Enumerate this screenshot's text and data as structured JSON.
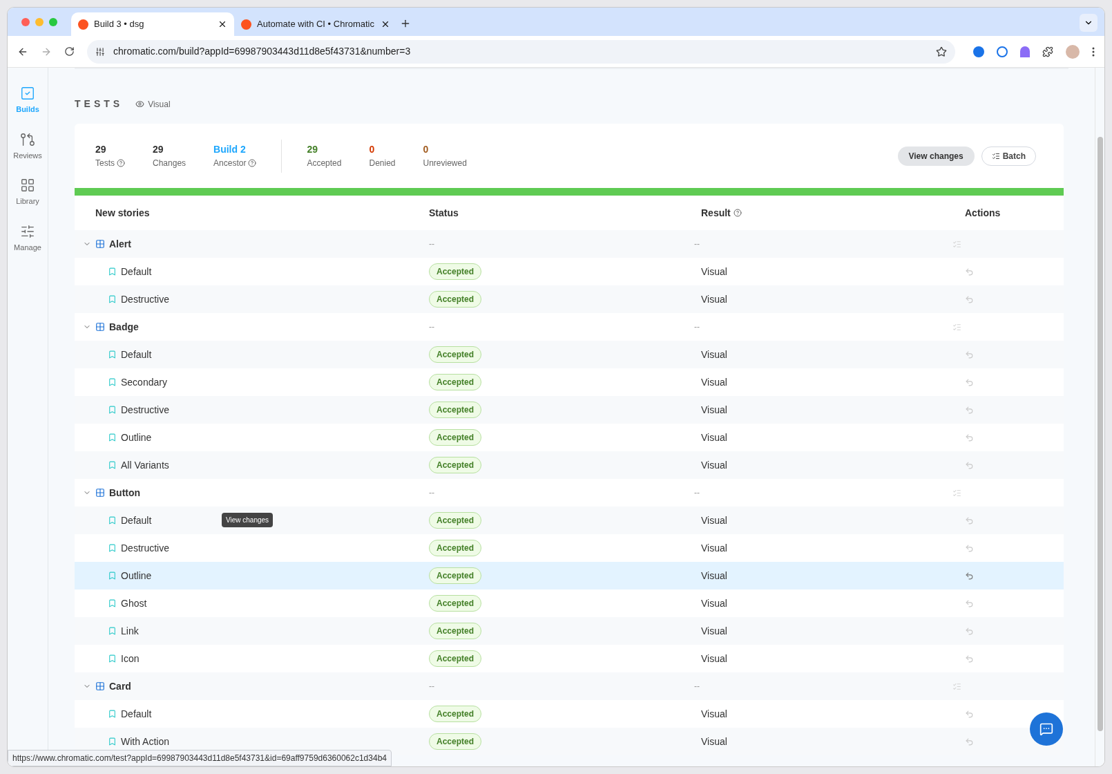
{
  "browser": {
    "tabs": [
      {
        "title": "Build 3 • dsg",
        "selected": true
      },
      {
        "title": "Automate with CI • Chromatic",
        "selected": false
      }
    ],
    "url": "chromatic.com/build?appId=69987903443d11d8e5f43731&number=3"
  },
  "sidebar": {
    "items": [
      {
        "label": "Builds",
        "selected": true
      },
      {
        "label": "Reviews",
        "selected": false
      },
      {
        "label": "Library",
        "selected": false
      },
      {
        "label": "Manage",
        "selected": false
      }
    ]
  },
  "section": {
    "title": "TESTS",
    "mode": "Visual"
  },
  "stats": [
    {
      "value": "29",
      "label": "Tests",
      "help": true,
      "kind": "plain"
    },
    {
      "value": "29",
      "label": "Changes",
      "help": false,
      "kind": "plain"
    },
    {
      "value": "Build 2",
      "label": "Ancestor",
      "help": true,
      "kind": "link"
    },
    {
      "value": "29",
      "label": "Accepted",
      "help": false,
      "kind": "accepted"
    },
    {
      "value": "0",
      "label": "Denied",
      "help": false,
      "kind": "denied"
    },
    {
      "value": "0",
      "label": "Unreviewed",
      "help": false,
      "kind": "unreviewed"
    }
  ],
  "buttons": {
    "view_changes": "View changes",
    "batch": "Batch"
  },
  "progress": {
    "level": 1
  },
  "table": {
    "columns": [
      "New stories",
      "Status",
      "Result",
      "Actions"
    ],
    "groups": [
      {
        "name": "Alert",
        "expanded": true,
        "status": "--",
        "result": "--",
        "stories": [
          {
            "name": "Default",
            "status": "Accepted",
            "result": "Visual",
            "highlighted": false
          },
          {
            "name": "Destructive",
            "status": "Accepted",
            "result": "Visual",
            "highlighted": false
          }
        ]
      },
      {
        "name": "Badge",
        "expanded": true,
        "status": "--",
        "result": "--",
        "stories": [
          {
            "name": "Default",
            "status": "Accepted",
            "result": "Visual",
            "highlighted": false
          },
          {
            "name": "Secondary",
            "status": "Accepted",
            "result": "Visual",
            "highlighted": false
          },
          {
            "name": "Destructive",
            "status": "Accepted",
            "result": "Visual",
            "highlighted": false
          },
          {
            "name": "Outline",
            "status": "Accepted",
            "result": "Visual",
            "highlighted": false
          },
          {
            "name": "All Variants",
            "status": "Accepted",
            "result": "Visual",
            "highlighted": false
          }
        ]
      },
      {
        "name": "Button",
        "expanded": true,
        "status": "--",
        "result": "--",
        "stories": [
          {
            "name": "Default",
            "status": "Accepted",
            "result": "Visual",
            "highlighted": false,
            "tooltip": "View changes"
          },
          {
            "name": "Destructive",
            "status": "Accepted",
            "result": "Visual",
            "highlighted": false
          },
          {
            "name": "Outline",
            "status": "Accepted",
            "result": "Visual",
            "highlighted": true
          },
          {
            "name": "Ghost",
            "status": "Accepted",
            "result": "Visual",
            "highlighted": false
          },
          {
            "name": "Link",
            "status": "Accepted",
            "result": "Visual",
            "highlighted": false
          },
          {
            "name": "Icon",
            "status": "Accepted",
            "result": "Visual",
            "highlighted": false
          }
        ]
      },
      {
        "name": "Card",
        "expanded": true,
        "status": "--",
        "result": "--",
        "stories": [
          {
            "name": "Default",
            "status": "Accepted",
            "result": "Visual",
            "highlighted": false
          },
          {
            "name": "With Action",
            "status": "Accepted",
            "result": "Visual",
            "highlighted": false
          }
        ]
      }
    ]
  },
  "status_url": "https://www.chromatic.com/test?appId=69987903443d11d8e5f43731&id=69aff9759d6360062c1d34b4"
}
